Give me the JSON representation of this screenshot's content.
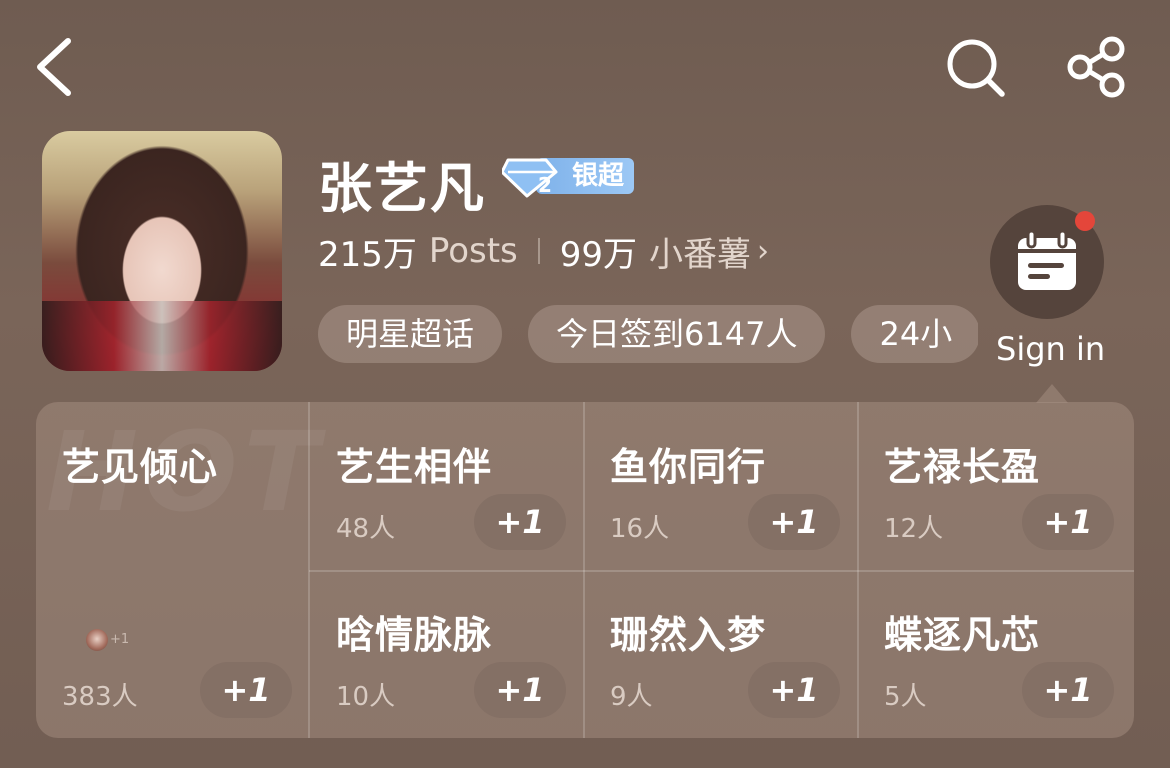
{
  "topbar": {
    "back_icon": "chevron-left-icon",
    "search_icon": "search-icon",
    "share_icon": "share-icon"
  },
  "profile": {
    "title": "张艺凡",
    "rank_badge": {
      "level": "2",
      "label": "银超"
    },
    "posts_count": "215万",
    "posts_label": "Posts",
    "fans_count": "99万",
    "fans_label": "小番薯",
    "fans_chevron": "›",
    "chips": [
      "明星超话",
      "今日签到6147人",
      "24小"
    ]
  },
  "signin": {
    "label": "Sign in",
    "icon": "calendar-icon",
    "has_notification": true,
    "notification_color": "#e4463a"
  },
  "panel": {
    "watermark": "HOT",
    "featured": {
      "name": "艺见倾心",
      "count": "383人",
      "avatar_extra": "+1",
      "action": "+1"
    },
    "groups": [
      {
        "name": "艺生相伴",
        "count": "48人",
        "action": "+1"
      },
      {
        "name": "鱼你同行",
        "count": "16人",
        "action": "+1"
      },
      {
        "name": "艺禄长盈",
        "count": "12人",
        "action": "+1"
      },
      {
        "name": "晗情脉脉",
        "count": "10人",
        "action": "+1"
      },
      {
        "name": "珊然入梦",
        "count": "9人",
        "action": "+1"
      },
      {
        "name": "蝶逐凡芯",
        "count": "5人",
        "action": "+1"
      }
    ]
  },
  "colors": {
    "background": "#7a6559",
    "rank_badge": "#8cbdf0",
    "notification": "#e4463a"
  }
}
